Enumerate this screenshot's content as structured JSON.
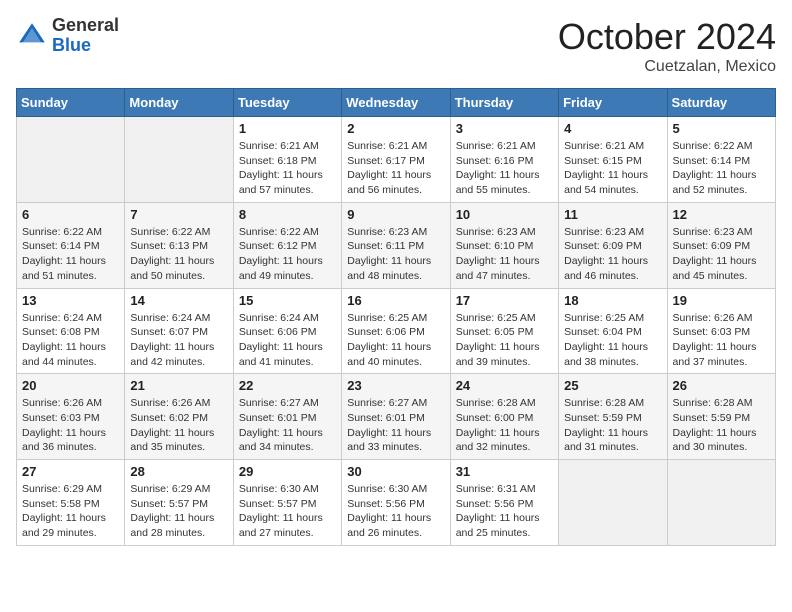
{
  "header": {
    "logo_general": "General",
    "logo_blue": "Blue",
    "month_title": "October 2024",
    "location": "Cuetzalan, Mexico"
  },
  "days_of_week": [
    "Sunday",
    "Monday",
    "Tuesday",
    "Wednesday",
    "Thursday",
    "Friday",
    "Saturday"
  ],
  "weeks": [
    [
      {
        "day": "",
        "info": ""
      },
      {
        "day": "",
        "info": ""
      },
      {
        "day": "1",
        "sunrise": "6:21 AM",
        "sunset": "6:18 PM",
        "daylight": "11 hours and 57 minutes."
      },
      {
        "day": "2",
        "sunrise": "6:21 AM",
        "sunset": "6:17 PM",
        "daylight": "11 hours and 56 minutes."
      },
      {
        "day": "3",
        "sunrise": "6:21 AM",
        "sunset": "6:16 PM",
        "daylight": "11 hours and 55 minutes."
      },
      {
        "day": "4",
        "sunrise": "6:21 AM",
        "sunset": "6:15 PM",
        "daylight": "11 hours and 54 minutes."
      },
      {
        "day": "5",
        "sunrise": "6:22 AM",
        "sunset": "6:14 PM",
        "daylight": "11 hours and 52 minutes."
      }
    ],
    [
      {
        "day": "6",
        "sunrise": "6:22 AM",
        "sunset": "6:14 PM",
        "daylight": "11 hours and 51 minutes."
      },
      {
        "day": "7",
        "sunrise": "6:22 AM",
        "sunset": "6:13 PM",
        "daylight": "11 hours and 50 minutes."
      },
      {
        "day": "8",
        "sunrise": "6:22 AM",
        "sunset": "6:12 PM",
        "daylight": "11 hours and 49 minutes."
      },
      {
        "day": "9",
        "sunrise": "6:23 AM",
        "sunset": "6:11 PM",
        "daylight": "11 hours and 48 minutes."
      },
      {
        "day": "10",
        "sunrise": "6:23 AM",
        "sunset": "6:10 PM",
        "daylight": "11 hours and 47 minutes."
      },
      {
        "day": "11",
        "sunrise": "6:23 AM",
        "sunset": "6:09 PM",
        "daylight": "11 hours and 46 minutes."
      },
      {
        "day": "12",
        "sunrise": "6:23 AM",
        "sunset": "6:09 PM",
        "daylight": "11 hours and 45 minutes."
      }
    ],
    [
      {
        "day": "13",
        "sunrise": "6:24 AM",
        "sunset": "6:08 PM",
        "daylight": "11 hours and 44 minutes."
      },
      {
        "day": "14",
        "sunrise": "6:24 AM",
        "sunset": "6:07 PM",
        "daylight": "11 hours and 42 minutes."
      },
      {
        "day": "15",
        "sunrise": "6:24 AM",
        "sunset": "6:06 PM",
        "daylight": "11 hours and 41 minutes."
      },
      {
        "day": "16",
        "sunrise": "6:25 AM",
        "sunset": "6:06 PM",
        "daylight": "11 hours and 40 minutes."
      },
      {
        "day": "17",
        "sunrise": "6:25 AM",
        "sunset": "6:05 PM",
        "daylight": "11 hours and 39 minutes."
      },
      {
        "day": "18",
        "sunrise": "6:25 AM",
        "sunset": "6:04 PM",
        "daylight": "11 hours and 38 minutes."
      },
      {
        "day": "19",
        "sunrise": "6:26 AM",
        "sunset": "6:03 PM",
        "daylight": "11 hours and 37 minutes."
      }
    ],
    [
      {
        "day": "20",
        "sunrise": "6:26 AM",
        "sunset": "6:03 PM",
        "daylight": "11 hours and 36 minutes."
      },
      {
        "day": "21",
        "sunrise": "6:26 AM",
        "sunset": "6:02 PM",
        "daylight": "11 hours and 35 minutes."
      },
      {
        "day": "22",
        "sunrise": "6:27 AM",
        "sunset": "6:01 PM",
        "daylight": "11 hours and 34 minutes."
      },
      {
        "day": "23",
        "sunrise": "6:27 AM",
        "sunset": "6:01 PM",
        "daylight": "11 hours and 33 minutes."
      },
      {
        "day": "24",
        "sunrise": "6:28 AM",
        "sunset": "6:00 PM",
        "daylight": "11 hours and 32 minutes."
      },
      {
        "day": "25",
        "sunrise": "6:28 AM",
        "sunset": "5:59 PM",
        "daylight": "11 hours and 31 minutes."
      },
      {
        "day": "26",
        "sunrise": "6:28 AM",
        "sunset": "5:59 PM",
        "daylight": "11 hours and 30 minutes."
      }
    ],
    [
      {
        "day": "27",
        "sunrise": "6:29 AM",
        "sunset": "5:58 PM",
        "daylight": "11 hours and 29 minutes."
      },
      {
        "day": "28",
        "sunrise": "6:29 AM",
        "sunset": "5:57 PM",
        "daylight": "11 hours and 28 minutes."
      },
      {
        "day": "29",
        "sunrise": "6:30 AM",
        "sunset": "5:57 PM",
        "daylight": "11 hours and 27 minutes."
      },
      {
        "day": "30",
        "sunrise": "6:30 AM",
        "sunset": "5:56 PM",
        "daylight": "11 hours and 26 minutes."
      },
      {
        "day": "31",
        "sunrise": "6:31 AM",
        "sunset": "5:56 PM",
        "daylight": "11 hours and 25 minutes."
      },
      {
        "day": "",
        "info": ""
      },
      {
        "day": "",
        "info": ""
      }
    ]
  ],
  "labels": {
    "sunrise": "Sunrise: ",
    "sunset": "Sunset: ",
    "daylight": "Daylight: "
  }
}
